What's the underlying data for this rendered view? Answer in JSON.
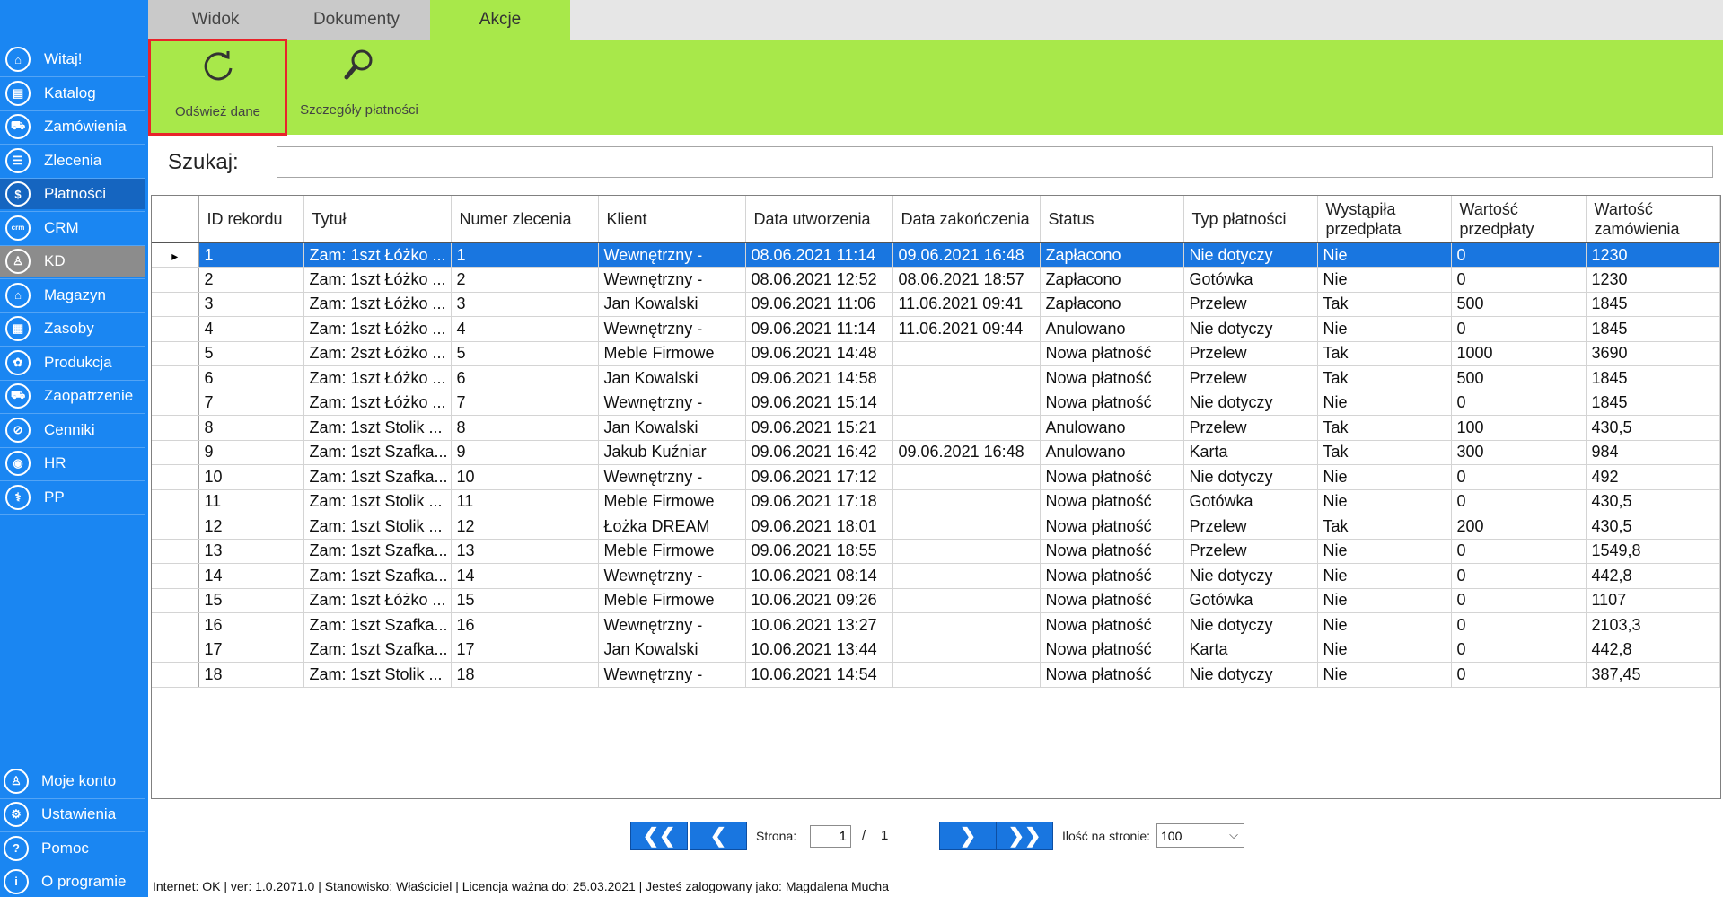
{
  "tabs": [
    "Widok",
    "Dokumenty",
    "Akcje"
  ],
  "ribbon": {
    "refresh_label": "Odśwież dane",
    "details_label": "Szczegóły płatności"
  },
  "sidebar": {
    "items": [
      {
        "label": "Witaj!",
        "icon": "home-icon",
        "glyph": "⌂"
      },
      {
        "label": "Katalog",
        "icon": "book-icon",
        "glyph": "▤"
      },
      {
        "label": "Zamówienia",
        "icon": "cart-icon",
        "glyph": "⛟"
      },
      {
        "label": "Zlecenia",
        "icon": "list-icon",
        "glyph": "☰"
      },
      {
        "label": "Płatności",
        "icon": "dollar-icon",
        "glyph": "$"
      },
      {
        "label": "CRM",
        "icon": "crm-icon",
        "glyph": "crm"
      },
      {
        "label": "KD",
        "icon": "person-icon",
        "glyph": "♙"
      },
      {
        "label": "Magazyn",
        "icon": "warehouse-icon",
        "glyph": "⌂"
      },
      {
        "label": "Zasoby",
        "icon": "resources-icon",
        "glyph": "▦"
      },
      {
        "label": "Produkcja",
        "icon": "production-icon",
        "glyph": "✿"
      },
      {
        "label": "Zaopatrzenie",
        "icon": "truck-icon",
        "glyph": "⛟"
      },
      {
        "label": "Cenniki",
        "icon": "tag-icon",
        "glyph": "⊘"
      },
      {
        "label": "HR",
        "icon": "hr-icon",
        "glyph": "◉"
      },
      {
        "label": "PP",
        "icon": "pp-icon",
        "glyph": "⚕"
      }
    ],
    "bottom_items": [
      {
        "label": "Moje konto",
        "icon": "user-icon",
        "glyph": "♙"
      },
      {
        "label": "Ustawienia",
        "icon": "settings-icon",
        "glyph": "⚙"
      },
      {
        "label": "Pomoc",
        "icon": "help-icon",
        "glyph": "?"
      },
      {
        "label": "O programie",
        "icon": "info-icon",
        "glyph": "i"
      }
    ]
  },
  "search": {
    "label": "Szukaj:",
    "value": ""
  },
  "table": {
    "columns": [
      "ID rekordu",
      "Tytuł",
      "Numer zlecenia",
      "Klient",
      "Data utworzenia",
      "Data zakończenia",
      "Status",
      "Typ płatności",
      "Wystąpiła przedpłata",
      "Wartość przedpłaty",
      "Wartość zamówienia"
    ],
    "rows": [
      [
        "1",
        "Zam: 1szt Łóżko ...",
        "1",
        "Wewnętrzny -",
        "08.06.2021 11:14",
        "09.06.2021 16:48",
        "Zapłacono",
        "Nie dotyczy",
        "Nie",
        "0",
        "1230"
      ],
      [
        "2",
        "Zam: 1szt Łóżko ...",
        "2",
        "Wewnętrzny -",
        "08.06.2021 12:52",
        "08.06.2021 18:57",
        "Zapłacono",
        "Gotówka",
        "Nie",
        "0",
        "1230"
      ],
      [
        "3",
        "Zam: 1szt Łóżko ...",
        "3",
        "Jan Kowalski",
        "09.06.2021 11:06",
        "11.06.2021 09:41",
        "Zapłacono",
        "Przelew",
        "Tak",
        "500",
        "1845"
      ],
      [
        "4",
        "Zam: 1szt Łóżko ...",
        "4",
        "Wewnętrzny -",
        "09.06.2021 11:14",
        "11.06.2021 09:44",
        "Anulowano",
        "Nie dotyczy",
        "Nie",
        "0",
        "1845"
      ],
      [
        "5",
        "Zam: 2szt Łóżko ...",
        "5",
        "Meble Firmowe",
        "09.06.2021 14:48",
        "",
        "Nowa płatność",
        "Przelew",
        "Tak",
        "1000",
        "3690"
      ],
      [
        "6",
        "Zam: 1szt Łóżko ...",
        "6",
        "Jan Kowalski",
        "09.06.2021 14:58",
        "",
        "Nowa płatność",
        "Przelew",
        "Tak",
        "500",
        "1845"
      ],
      [
        "7",
        "Zam: 1szt Łóżko ...",
        "7",
        "Wewnętrzny -",
        "09.06.2021 15:14",
        "",
        "Nowa płatność",
        "Nie dotyczy",
        "Nie",
        "0",
        "1845"
      ],
      [
        "8",
        "Zam: 1szt Stolik ...",
        "8",
        "Jan Kowalski",
        "09.06.2021 15:21",
        "",
        "Anulowano",
        "Przelew",
        "Tak",
        "100",
        "430,5"
      ],
      [
        "9",
        "Zam: 1szt Szafka...",
        "9",
        "Jakub Kuźniar",
        "09.06.2021 16:42",
        "09.06.2021 16:48",
        "Anulowano",
        "Karta",
        "Tak",
        "300",
        "984"
      ],
      [
        "10",
        "Zam: 1szt Szafka...",
        "10",
        "Wewnętrzny -",
        "09.06.2021 17:12",
        "",
        "Nowa płatność",
        "Nie dotyczy",
        "Nie",
        "0",
        "492"
      ],
      [
        "11",
        "Zam: 1szt Stolik ...",
        "11",
        "Meble Firmowe",
        "09.06.2021 17:18",
        "",
        "Nowa płatność",
        "Gotówka",
        "Nie",
        "0",
        "430,5"
      ],
      [
        "12",
        "Zam: 1szt Stolik ...",
        "12",
        "Łożka DREAM",
        "09.06.2021 18:01",
        "",
        "Nowa płatność",
        "Przelew",
        "Tak",
        "200",
        "430,5"
      ],
      [
        "13",
        "Zam: 1szt Szafka...",
        "13",
        "Meble Firmowe",
        "09.06.2021 18:55",
        "",
        "Nowa płatność",
        "Przelew",
        "Nie",
        "0",
        "1549,8"
      ],
      [
        "14",
        "Zam: 1szt Szafka...",
        "14",
        "Wewnętrzny -",
        "10.06.2021 08:14",
        "",
        "Nowa płatność",
        "Nie dotyczy",
        "Nie",
        "0",
        "442,8"
      ],
      [
        "15",
        "Zam: 1szt Łóżko ...",
        "15",
        "Meble Firmowe",
        "10.06.2021 09:26",
        "",
        "Nowa płatność",
        "Gotówka",
        "Nie",
        "0",
        "1107"
      ],
      [
        "16",
        "Zam: 1szt Szafka...",
        "16",
        "Wewnętrzny -",
        "10.06.2021 13:27",
        "",
        "Nowa płatność",
        "Nie dotyczy",
        "Nie",
        "0",
        "2103,3"
      ],
      [
        "17",
        "Zam: 1szt Szafka...",
        "17",
        "Jan Kowalski",
        "10.06.2021 13:44",
        "",
        "Nowa płatność",
        "Karta",
        "Nie",
        "0",
        "442,8"
      ],
      [
        "18",
        "Zam: 1szt Stolik ...",
        "18",
        "Wewnętrzny -",
        "10.06.2021 14:54",
        "",
        "Nowa płatność",
        "Nie dotyczy",
        "Nie",
        "0",
        "387,45"
      ]
    ]
  },
  "pager": {
    "page_label": "Strona:",
    "current_page": "1",
    "separator": "/",
    "total_pages": "1",
    "page_size_label": "Ilość na stronie:",
    "page_size": "100"
  },
  "status": {
    "text": "Internet: OK  |   ver: 1.0.2071.0   |   Stanowisko: Właściciel    |   Licencja ważna do: 25.03.2021   |   Jesteś zalogowany jako: Magdalena Mucha"
  },
  "colors": {
    "sidebar": "#1a86f2",
    "ribbon": "#a8e84a",
    "selection": "#1976e0",
    "highlight_border": "#e8242b"
  }
}
